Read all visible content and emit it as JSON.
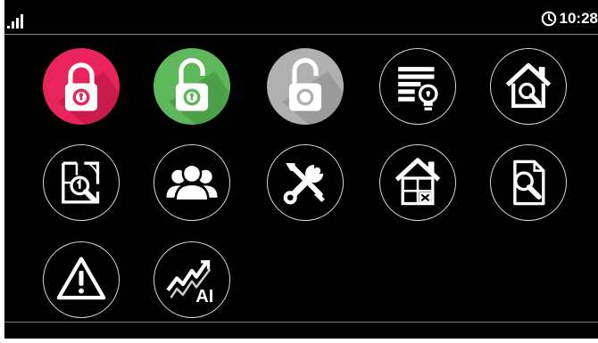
{
  "status": {
    "signal_icon": "signal-bars-icon",
    "clock_icon": "clock-icon",
    "time": "10:28"
  },
  "colors": {
    "background": "#000000",
    "lock_red": "#e8245a",
    "lock_green": "#5eb75a",
    "lock_gray": "#b0b0b0",
    "outline": "#d8d8d8"
  },
  "tiles": [
    {
      "icon": "padlock-closed-icon",
      "color": "#e8245a"
    },
    {
      "icon": "padlock-open-icon",
      "color": "#5eb75a"
    },
    {
      "icon": "padlock-open-disabled-icon",
      "color": "#b0b0b0"
    },
    {
      "icon": "event-log-lightbulb-icon"
    },
    {
      "icon": "house-search-icon"
    },
    {
      "icon": "floorplan-search-icon"
    },
    {
      "icon": "users-group-icon"
    },
    {
      "icon": "wrench-screwdriver-icon"
    },
    {
      "icon": "house-window-icon"
    },
    {
      "icon": "document-search-icon"
    },
    {
      "icon": "warning-triangle-icon"
    },
    {
      "icon": "ai-trend-icon",
      "label": "AI"
    }
  ]
}
